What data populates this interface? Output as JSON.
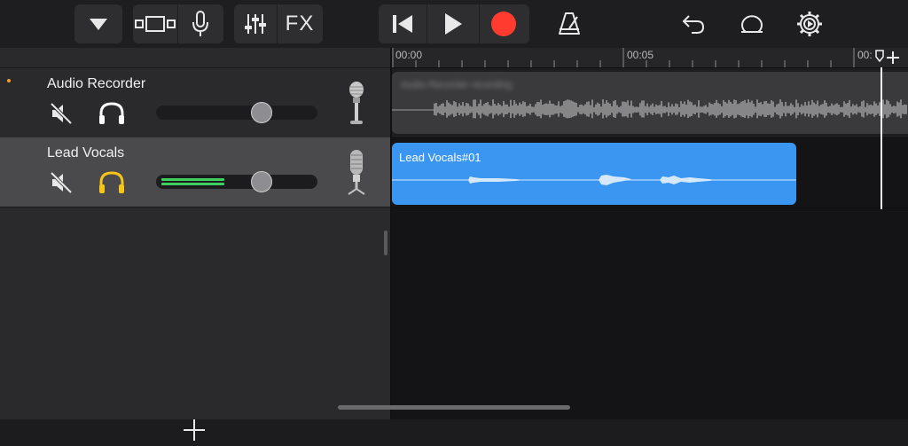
{
  "toolbar": {
    "fx_label": "FX"
  },
  "timeline": {
    "ruler_labels": [
      "00:00",
      "00:05",
      "00:"
    ]
  },
  "tracks": [
    {
      "name": "Audio Recorder",
      "volume": 0.68,
      "meter_level": 0,
      "headphone_color": "#ffffff",
      "region_label": "Audio Recorder recording"
    },
    {
      "name": "Lead Vocals",
      "volume": 0.68,
      "meter_level": 0.42,
      "headphone_color": "#f5c518",
      "region_label": "Lead Vocals#01"
    }
  ],
  "colors": {
    "accent_blue": "#3a96f0",
    "record_red": "#ff3b30",
    "meter_green": "#3ed160",
    "track_dot": "#f0a020"
  }
}
